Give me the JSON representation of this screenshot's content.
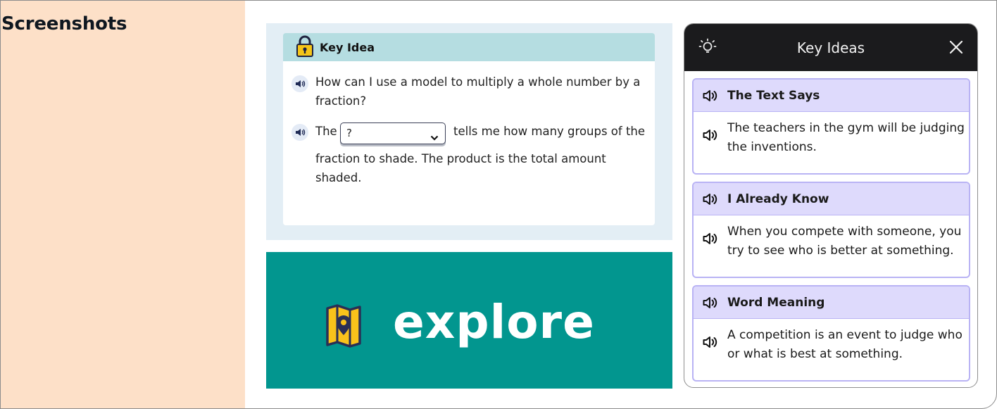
{
  "left_panel": {
    "title": "Screenshots"
  },
  "key_idea": {
    "title": "Key Idea",
    "question": "How can I use a model to multiply a whole number by a fraction?",
    "sentence_prefix": "The",
    "dropdown_value": "?",
    "sentence_suffix": "tells me how many groups of the",
    "sentence_line2": "fraction to shade. The product is the total amount shaded."
  },
  "explore": {
    "label": "explore"
  },
  "key_ideas_panel": {
    "title": "Key Ideas",
    "cards": [
      {
        "heading": "The Text Says",
        "text": "The teachers in the gym will be judging the inventions."
      },
      {
        "heading": "I Already Know",
        "text": "When you compete with someone, you try to see who is better at something."
      },
      {
        "heading": "Word Meaning",
        "text": "A competition is an event to judge who or what is best at something."
      }
    ]
  },
  "colors": {
    "left_panel_bg": "#fde0c8",
    "key_idea_header": "#b5dde1",
    "explore_bg": "#02968f",
    "card_header": "#dedafc",
    "card_border": "#b9b3f4",
    "panel_header": "#1b1b1d"
  },
  "icons": [
    "lock-icon",
    "speaker-icon",
    "chevron-down-icon",
    "map-pin-icon",
    "lightbulb-icon",
    "close-icon"
  ]
}
